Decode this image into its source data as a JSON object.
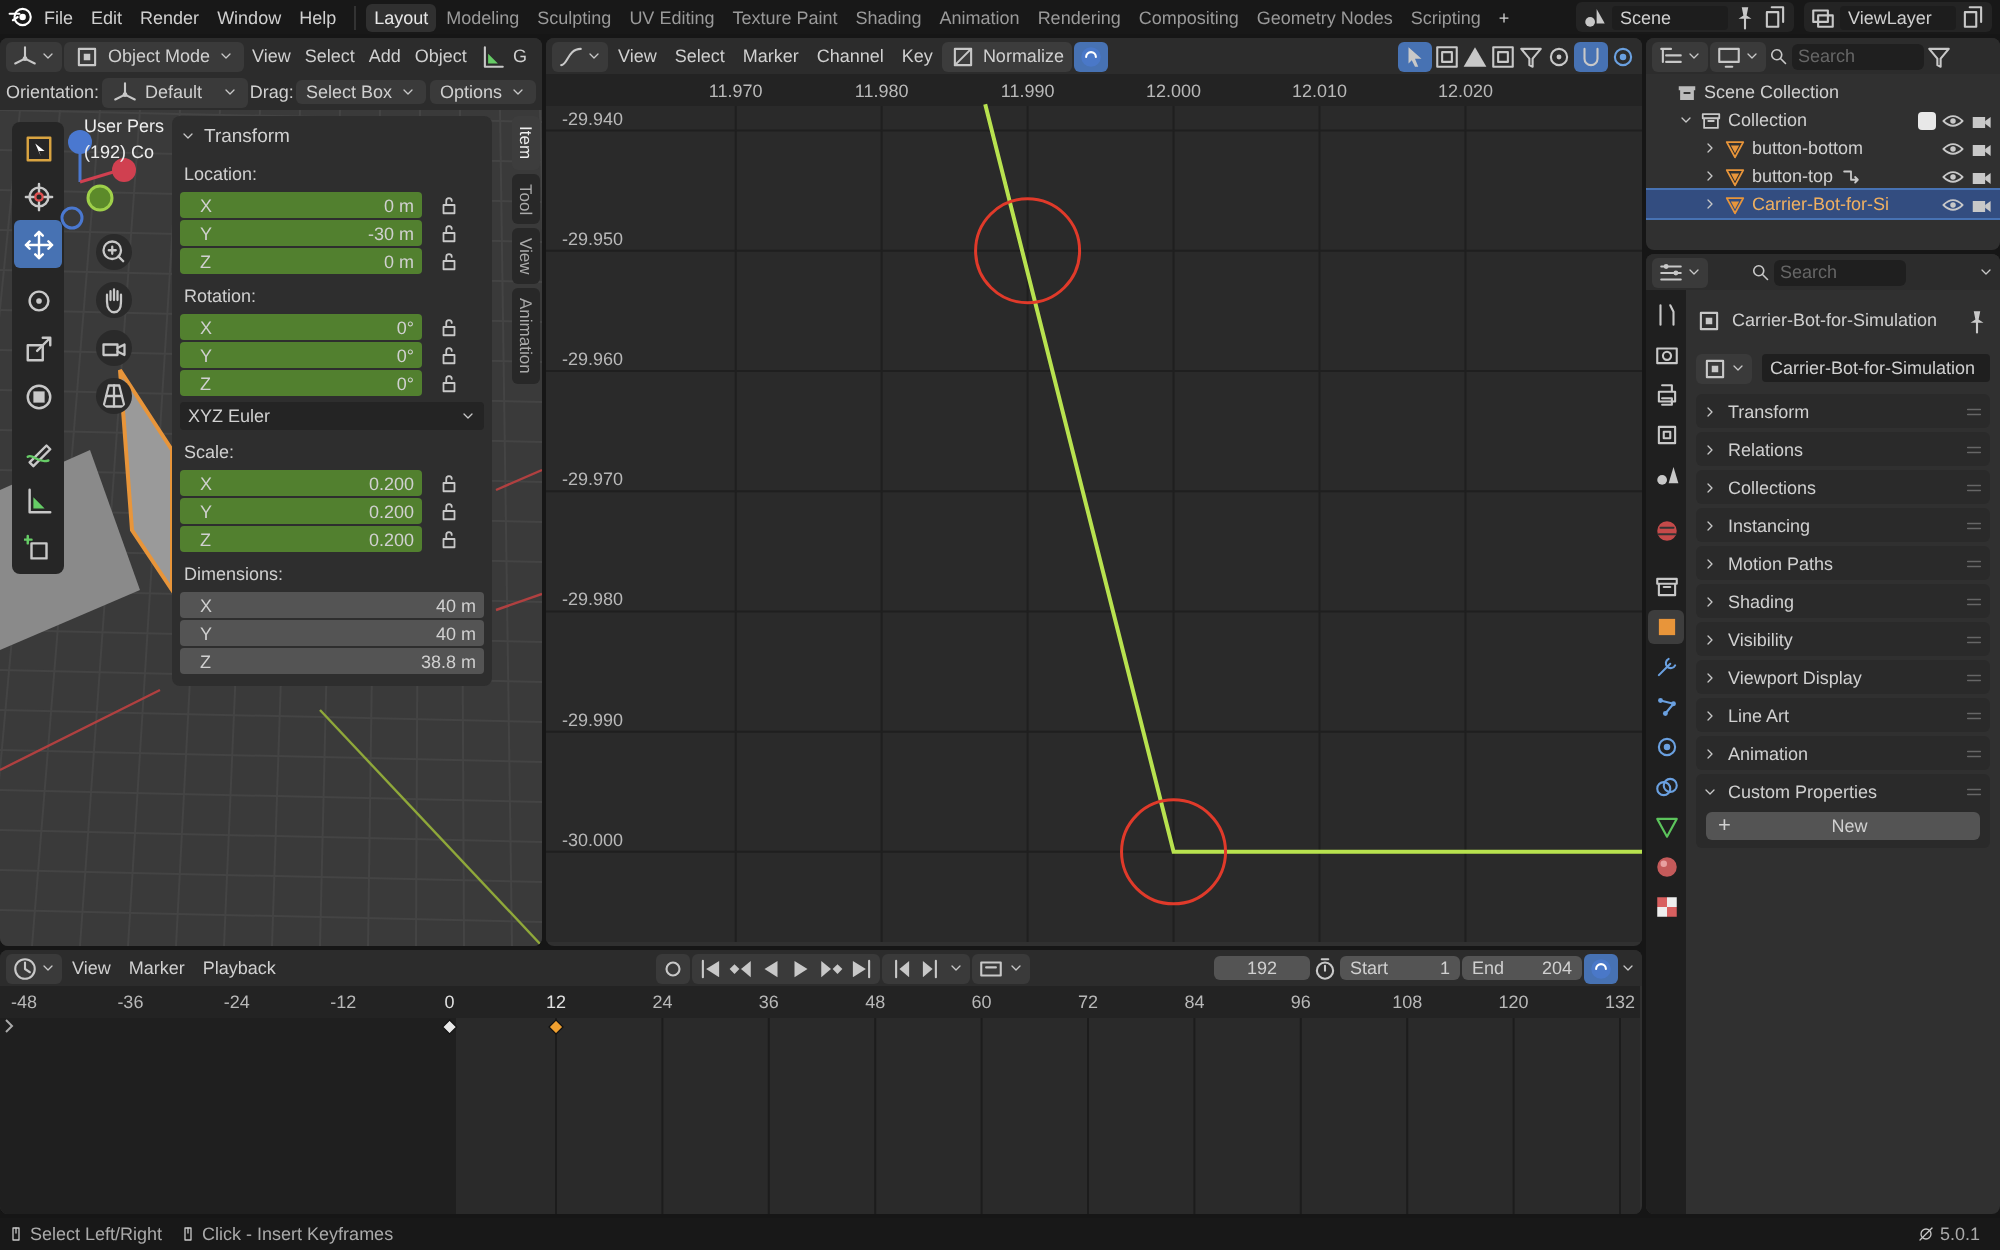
{
  "top_bar": {
    "menus": [
      "File",
      "Edit",
      "Render",
      "Window",
      "Help"
    ],
    "workspaces": [
      {
        "label": "Layout",
        "selected": true
      },
      {
        "label": "Modeling",
        "selected": false
      },
      {
        "label": "Sculpting",
        "selected": false
      },
      {
        "label": "UV Editing",
        "selected": false
      },
      {
        "label": "Texture Paint",
        "selected": false
      },
      {
        "label": "Shading",
        "selected": false
      },
      {
        "label": "Animation",
        "selected": false
      },
      {
        "label": "Rendering",
        "selected": false
      },
      {
        "label": "Compositing",
        "selected": false
      },
      {
        "label": "Geometry Nodes",
        "selected": false
      },
      {
        "label": "Scripting",
        "selected": false
      }
    ],
    "add_workspace": "+",
    "scene": "Scene",
    "view_layer": "ViewLayer"
  },
  "viewport": {
    "mode": "Object Mode",
    "menus": [
      "View",
      "Select",
      "Add",
      "Object"
    ],
    "cut_menu": "G",
    "orientation_label": "Orientation:",
    "orientation": "Default",
    "drag_label": "Drag:",
    "drag": "Select Box",
    "options": "Options",
    "overlay_text": [
      "User Pers",
      "(192) Co"
    ],
    "tools": [
      {
        "kind": "select_box",
        "selected": false
      },
      {
        "kind": "cursor",
        "selected": false
      },
      {
        "kind": "move",
        "selected": true
      },
      {
        "kind": "rotate",
        "selected": false
      },
      {
        "kind": "scale",
        "selected": false
      },
      {
        "kind": "transform",
        "selected": false
      },
      {
        "kind": "annotate",
        "selected": false
      },
      {
        "kind": "measure",
        "selected": false
      },
      {
        "kind": "add_cube",
        "selected": false
      }
    ],
    "sidebar": {
      "tabs": [
        {
          "label": "Item",
          "selected": true
        },
        {
          "label": "Tool",
          "selected": false
        },
        {
          "label": "View",
          "selected": false
        },
        {
          "label": "Animation",
          "selected": false
        }
      ],
      "panel": {
        "title": "Transform",
        "expanded": true,
        "groups": [
          {
            "label": "Location:",
            "lockable": true,
            "fields": [
              {
                "axis": "X",
                "value": "0 m",
                "keyed": true
              },
              {
                "axis": "Y",
                "value": "-30 m",
                "keyed": true
              },
              {
                "axis": "Z",
                "value": "0 m",
                "keyed": true
              }
            ]
          },
          {
            "label": "Rotation:",
            "lockable": true,
            "fields": [
              {
                "axis": "X",
                "value": "0°",
                "keyed": true
              },
              {
                "axis": "Y",
                "value": "0°",
                "keyed": true
              },
              {
                "axis": "Z",
                "value": "0°",
                "keyed": true
              }
            ],
            "mode": "XYZ Euler"
          },
          {
            "label": "Scale:",
            "lockable": true,
            "fields": [
              {
                "axis": "X",
                "value": "0.200",
                "keyed": true
              },
              {
                "axis": "Y",
                "value": "0.200",
                "keyed": true
              },
              {
                "axis": "Z",
                "value": "0.200",
                "keyed": true
              }
            ]
          },
          {
            "label": "Dimensions:",
            "lockable": false,
            "fields": [
              {
                "axis": "X",
                "value": "40 m",
                "keyed": false
              },
              {
                "axis": "Y",
                "value": "40 m",
                "keyed": false
              },
              {
                "axis": "Z",
                "value": "38.8 m",
                "keyed": false
              }
            ]
          }
        ]
      }
    }
  },
  "graph_editor": {
    "menus": [
      "View",
      "Select",
      "Marker",
      "Channel",
      "Key"
    ],
    "normalize": {
      "label": "Normalize",
      "on": false
    },
    "chart_data": {
      "type": "line",
      "x": [
        11.9871,
        12.0,
        12.0321
      ],
      "series": [
        {
          "color": "#b8e24f",
          "values": [
            -29.9378,
            -30.0,
            -30.0
          ]
        }
      ],
      "xlim": [
        11.957,
        12.0321
      ],
      "ylim": [
        -30.0075,
        -29.9318
      ],
      "grid": true,
      "xticks": [
        {
          "value": 11.97,
          "label": "11.970"
        },
        {
          "value": 11.98,
          "label": "11.980"
        },
        {
          "value": 11.99,
          "label": "11.990"
        },
        {
          "value": 12.0,
          "label": "12.000"
        },
        {
          "value": 12.01,
          "label": "12.010"
        },
        {
          "value": 12.02,
          "label": "12.020"
        }
      ],
      "yticks": [
        {
          "value": -29.94,
          "label": "-29.940"
        },
        {
          "value": -29.95,
          "label": "-29.950"
        },
        {
          "value": -29.96,
          "label": "-29.960"
        },
        {
          "value": -29.97,
          "label": "-29.970"
        },
        {
          "value": -29.98,
          "label": "-29.980"
        },
        {
          "value": -29.99,
          "label": "-29.990"
        },
        {
          "value": -30.0,
          "label": "-30.000"
        }
      ]
    }
  },
  "outliner": {
    "search_placeholder": "Search",
    "tree": [
      {
        "label": "Scene Collection",
        "kind": "scene_collection",
        "selected": false,
        "children": [
          {
            "label": "Collection",
            "kind": "collection",
            "selected": false,
            "expanded": true,
            "checked": true,
            "children": [
              {
                "label": "button-bottom",
                "kind": "mesh",
                "selected": false,
                "expanded": false,
                "constraint": false
              },
              {
                "label": "button-top",
                "kind": "mesh",
                "selected": false,
                "expanded": false,
                "constraint": true
              },
              {
                "label": "Carrier-Bot-for-Si",
                "kind": "mesh",
                "selected": true,
                "expanded": false,
                "constraint": false
              }
            ]
          }
        ]
      }
    ]
  },
  "properties": {
    "search_placeholder": "Search",
    "tabs": [
      {
        "kind": "tool",
        "selected": false
      },
      {
        "kind": "render",
        "selected": false
      },
      {
        "kind": "output",
        "selected": false
      },
      {
        "kind": "view_layer",
        "selected": false
      },
      {
        "kind": "scene",
        "selected": false
      },
      {
        "kind": "world",
        "selected": false
      },
      {
        "kind": "collection",
        "selected": false
      },
      {
        "kind": "object",
        "selected": true
      },
      {
        "kind": "modifiers",
        "selected": false
      },
      {
        "kind": "particles",
        "selected": false
      },
      {
        "kind": "physics",
        "selected": false
      },
      {
        "kind": "constraints",
        "selected": false
      },
      {
        "kind": "data",
        "selected": false
      },
      {
        "kind": "material",
        "selected": false
      },
      {
        "kind": "texture",
        "selected": false
      }
    ],
    "object_name": "Carrier-Bot-for-Simulation",
    "data_name": "Carrier-Bot-for-Simulation",
    "panels": [
      {
        "title": "Transform",
        "expanded": false
      },
      {
        "title": "Relations",
        "expanded": false
      },
      {
        "title": "Collections",
        "expanded": false
      },
      {
        "title": "Instancing",
        "expanded": false
      },
      {
        "title": "Motion Paths",
        "expanded": false
      },
      {
        "title": "Shading",
        "expanded": false
      },
      {
        "title": "Visibility",
        "expanded": false
      },
      {
        "title": "Viewport Display",
        "expanded": false
      },
      {
        "title": "Line Art",
        "expanded": false
      },
      {
        "title": "Animation",
        "expanded": false
      },
      {
        "title": "Custom Properties",
        "expanded": true
      }
    ],
    "new_button": {
      "icon": "+",
      "label": "New"
    }
  },
  "timeline": {
    "menus": [
      "View",
      "Marker",
      "Playback"
    ],
    "current_frame": "192",
    "start_label": "Start",
    "start": "1",
    "end_label": "End",
    "end": "204",
    "ruler": [
      {
        "label": "-48",
        "keyframe": false
      },
      {
        "label": "-36",
        "keyframe": false
      },
      {
        "label": "-24",
        "keyframe": false
      },
      {
        "label": "-12",
        "keyframe": false
      },
      {
        "label": "0",
        "keyframe": true,
        "selected": false
      },
      {
        "label": "12",
        "keyframe": true,
        "selected": true
      },
      {
        "label": "24",
        "keyframe": false
      },
      {
        "label": "36",
        "keyframe": false
      },
      {
        "label": "48",
        "keyframe": false
      },
      {
        "label": "60",
        "keyframe": false
      },
      {
        "label": "72",
        "keyframe": false
      },
      {
        "label": "84",
        "keyframe": false
      },
      {
        "label": "96",
        "keyframe": false
      },
      {
        "label": "108",
        "keyframe": false
      },
      {
        "label": "120",
        "keyframe": false
      },
      {
        "label": "132",
        "keyframe": false
      }
    ]
  },
  "status_bar": {
    "hints": [
      "Select Left/Right",
      "Click - Insert Keyframes"
    ],
    "version": "5.0.1"
  }
}
